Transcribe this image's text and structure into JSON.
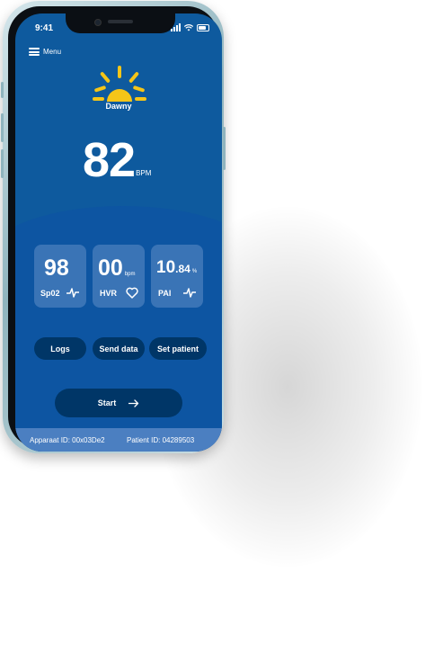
{
  "status_bar": {
    "time": "9:41"
  },
  "header": {
    "menu_label": "Menu"
  },
  "brand": {
    "name": "Dawny"
  },
  "heart_rate": {
    "value": "82",
    "unit": "BPM"
  },
  "cards": [
    {
      "value": "98",
      "unit": "",
      "label": "Sp02",
      "icon": "pulse-icon"
    },
    {
      "value": "00",
      "unit": "bpm",
      "label": "HVR",
      "icon": "heart-icon"
    },
    {
      "value": "10",
      "decimal": ".84",
      "unit": "%",
      "label": "PAI",
      "icon": "pulse-icon"
    }
  ],
  "actions": {
    "logs": "Logs",
    "send_data": "Send data",
    "set_patient": "Set patient"
  },
  "start": {
    "label": "Start",
    "icon": "arrow-right-icon"
  },
  "footer": {
    "device_id": "Apparaat ID:  00x03De2",
    "patient_id": "Patient ID:  04289503"
  },
  "colors": {
    "screen": "#0e5a9e",
    "card": "#3a74b6",
    "button": "#003667",
    "footer": "#4b7fc1",
    "sun": "#f5c518"
  }
}
